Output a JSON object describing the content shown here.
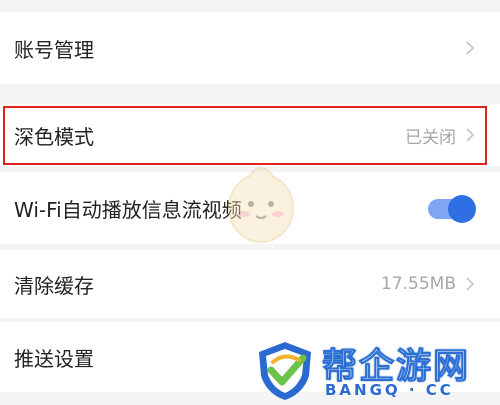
{
  "settings": {
    "items": [
      {
        "label": "账号管理",
        "value": ""
      },
      {
        "label": "深色模式",
        "value": "已关闭"
      },
      {
        "label": "Wi-Fi自动播放信息流视频",
        "value": ""
      },
      {
        "label": "清除缓存",
        "value": "17.55MB"
      },
      {
        "label": "推送设置",
        "value": ""
      }
    ],
    "wifi_autoplay_enabled": true
  },
  "colors": {
    "highlight": "#e0221f",
    "toggle_on": "#2f6fe4",
    "text": "#222222",
    "secondary_text": "#a6a6a6",
    "background": "#f4f4f4"
  },
  "icons": [
    "chevron-right-icon",
    "mascot-icon",
    "watermark-logo-icon"
  ],
  "watermark": {
    "title": "帮企游网",
    "sub": "BANGQ · CC"
  }
}
